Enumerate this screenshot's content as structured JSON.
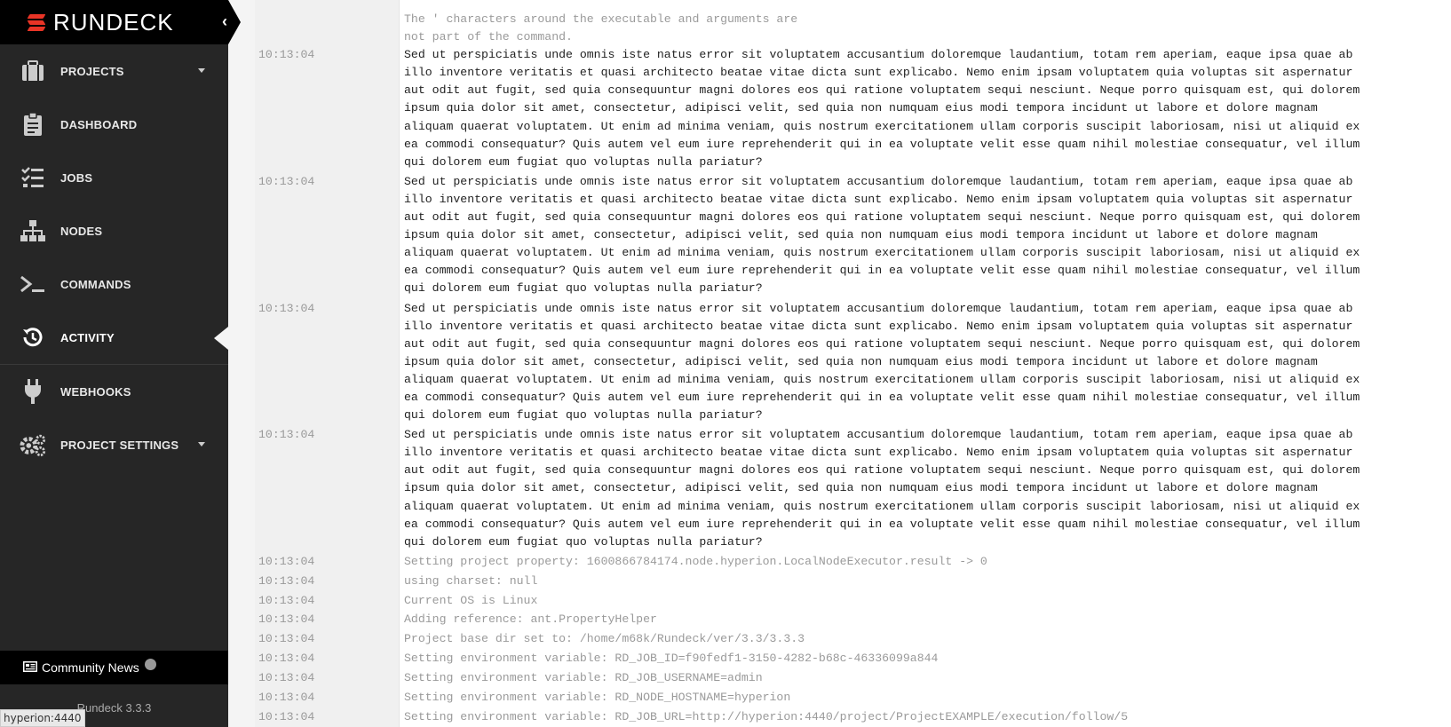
{
  "brand": {
    "name": "RUNDECK"
  },
  "sidebar": {
    "items": [
      {
        "label": "PROJECTS",
        "icon": "briefcase-icon",
        "has_caret": true
      },
      {
        "label": "DASHBOARD",
        "icon": "clipboard-icon"
      },
      {
        "label": "JOBS",
        "icon": "task-list-icon"
      },
      {
        "label": "NODES",
        "icon": "sitemap-icon"
      },
      {
        "label": "COMMANDS",
        "icon": "terminal-icon"
      },
      {
        "label": "ACTIVITY",
        "icon": "history-icon",
        "active": true
      },
      {
        "label": "WEBHOOKS",
        "icon": "plug-icon"
      },
      {
        "label": "PROJECT SETTINGS",
        "icon": "gears-icon",
        "has_caret": true
      }
    ],
    "news": "Community News",
    "version": "Rundeck 3.3.3"
  },
  "statusbar": "hyperion:4440",
  "log": {
    "header_lines": [
      "The ' characters around the executable and arguments are",
      "not part of the command."
    ],
    "lorem_time": "10:13:04",
    "lorem_lines": [
      "Sed ut perspiciatis unde omnis iste natus error sit voluptatem accusantium doloremque laudantium, totam rem aperiam, eaque ipsa quae ab",
      "illo inventore veritatis et quasi architecto beatae vitae dicta sunt explicabo. Nemo enim ipsam voluptatem quia voluptas sit aspernatur",
      "aut odit aut fugit, sed quia consequuntur magni dolores eos qui ratione voluptatem sequi nesciunt. Neque porro quisquam est, qui dolorem",
      "ipsum quia dolor sit amet, consectetur, adipisci velit, sed quia non numquam eius modi tempora incidunt ut labore et dolore magnam",
      "aliquam quaerat voluptatem. Ut enim ad minima veniam, quis nostrum exercitationem ullam corporis suscipit laboriosam, nisi ut aliquid ex",
      "ea commodi consequatur? Quis autem vel eum iure reprehenderit qui in ea voluptate velit esse quam nihil molestiae consequatur, vel illum",
      "qui dolorem eum fugiat quo voluptas nulla pariatur?"
    ],
    "lorem_count": 4,
    "entries": [
      {
        "time": "10:13:04",
        "text": "Setting project property: 1600866784174.node.hyperion.LocalNodeExecutor.result -> 0"
      },
      {
        "time": "10:13:04",
        "text": "using charset: null"
      },
      {
        "time": "10:13:04",
        "text": "Current OS is Linux"
      },
      {
        "time": "10:13:04",
        "text": "Adding reference: ant.PropertyHelper"
      },
      {
        "time": "10:13:04",
        "text": "Project base dir set to: /home/m68k/Rundeck/ver/3.3/3.3.3"
      },
      {
        "time": "10:13:04",
        "text": "Setting environment variable: RD_JOB_ID=f90fedf1-3150-4282-b68c-46336099a844"
      },
      {
        "time": "10:13:04",
        "text": "Setting environment variable: RD_JOB_USERNAME=admin"
      },
      {
        "time": "10:13:04",
        "text": "Setting environment variable: RD_NODE_HOSTNAME=hyperion"
      },
      {
        "time": "10:13:04",
        "text": "Setting environment variable: RD_JOB_URL=http://hyperion:4440/project/ProjectEXAMPLE/execution/follow/5"
      }
    ]
  }
}
